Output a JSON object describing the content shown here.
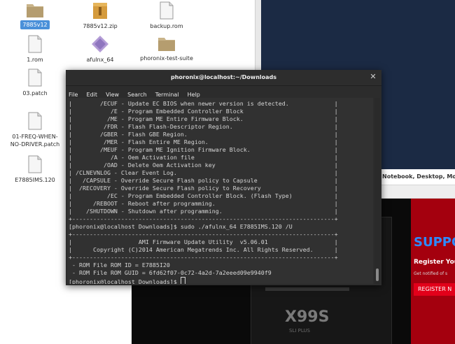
{
  "file_manager": {
    "files": [
      {
        "name": "7885v12",
        "icon": "folder-icon",
        "selected": true
      },
      {
        "name": "7885v12.zip",
        "icon": "zip-archive-icon"
      },
      {
        "name": "backup.rom",
        "icon": "document-icon"
      },
      {
        "name": "1.rom",
        "icon": "document-icon"
      },
      {
        "name": "afulnx_64",
        "icon": "executable-icon"
      },
      {
        "name": "phoronix-test-suite",
        "icon": "folder-icon"
      },
      {
        "name": "03.patch",
        "icon": "document-icon"
      },
      {
        "name": "01-FREQ-WHEN-\nNO-DRIVER.patch",
        "icon": "document-icon"
      },
      {
        "name": "E7885IMS.120",
        "icon": "document-icon"
      }
    ]
  },
  "browser": {
    "tab_text": "Notebook, Desktop, Mot"
  },
  "ad": {
    "support": "SUPPORT",
    "register_heading": "Register Your P",
    "notify": "Get notified of s",
    "register_button": "REGISTER N",
    "board_model": "X99S",
    "board_sub": "SLI PLUS"
  },
  "terminal": {
    "title": "phoronix@localhost:~/Downloads",
    "menu": [
      "File",
      "Edit",
      "View",
      "Search",
      "Terminal",
      "Help"
    ],
    "lines": [
      "|        /ECUF - Update EC BIOS when newer version is detected.             |",
      "|           /E - Program Embedded Controller Block                          |",
      "|          /ME - Program ME Entire Firmware Block.                          |",
      "|         /FDR - Flash Flash-Descriptor Region.                             |",
      "|        /GBER - Flash GBE Region.                                          |",
      "|         /MER - Flash Entire ME Region.                                    |",
      "|        /MEUF - Program ME Ignition Firmware Block.                        |",
      "|           /A - Oem Activation file                                        |",
      "|         /OAD - Delete Oem Activation key                                  |",
      "| /CLNEVNLOG - Clear Event Log.                                             |",
      "|   /CAPSULE - Override Secure Flash policy to Capsule                      |",
      "|  /RECOVERY - Override Secure Flash policy to Recovery                     |",
      "|          /EC - Program Embedded Controller Block. (Flash Type)            |",
      "|      /REBOOT - Reboot after programming.                                  |",
      "|    /SHUTDOWN - Shutdown after programming.                                |",
      "+---------------------------------------------------------------------------+",
      "[phoronix@localhost Downloads]$ sudo ./afulnx_64 E7885IMS.120 /U",
      "+---------------------------------------------------------------------------+",
      "|                   AMI Firmware Update Utility  v5.06.01                   |",
      "|      Copyright (C)2014 American Megatrends Inc. All Rights Reserved.      |",
      "+---------------------------------------------------------------------------+",
      " - ROM File ROM ID = E7885I20",
      " - ROM File ROM GUID = 6fd62f07-0c72-4a2d-7a2eeed09e9940f9",
      "[phoronix@localhost Downloads]$ "
    ]
  }
}
